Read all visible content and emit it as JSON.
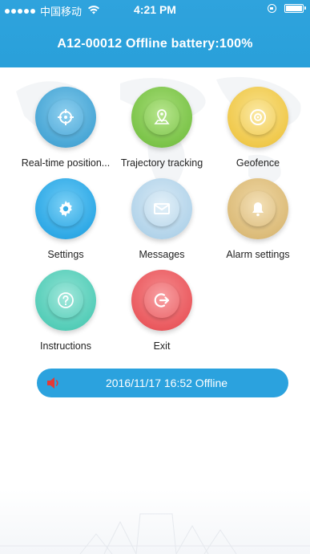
{
  "status_bar": {
    "carrier": "中国移动",
    "time": "4:21 PM"
  },
  "header": {
    "title": "A12-00012 Offline battery:100%"
  },
  "menu": [
    {
      "label": "Real-time position...",
      "icon": "crosshair-icon",
      "color": "#4aa7d6"
    },
    {
      "label": "Trajectory tracking",
      "icon": "map-pin-icon",
      "color": "#7cc44a"
    },
    {
      "label": "Geofence",
      "icon": "target-disc-icon",
      "color": "#f0c94c"
    },
    {
      "label": "Settings",
      "icon": "gear-icon",
      "color": "#2fa9e6"
    },
    {
      "label": "Messages",
      "icon": "envelope-icon",
      "color": "#b3d4ea"
    },
    {
      "label": "Alarm settings",
      "icon": "bell-icon",
      "color": "#dcbc7a"
    },
    {
      "label": "Instructions",
      "icon": "question-icon",
      "color": "#55cdb8"
    },
    {
      "label": "Exit",
      "icon": "exit-icon",
      "color": "#ea5a5f"
    }
  ],
  "status_pill": {
    "text": "2016/11/17 16:52 Offline",
    "icon": "speaker-icon"
  },
  "colors": {
    "header_bg": "#2fa3dd",
    "pill_bg": "#2ba2de",
    "speaker": "#e53935"
  }
}
